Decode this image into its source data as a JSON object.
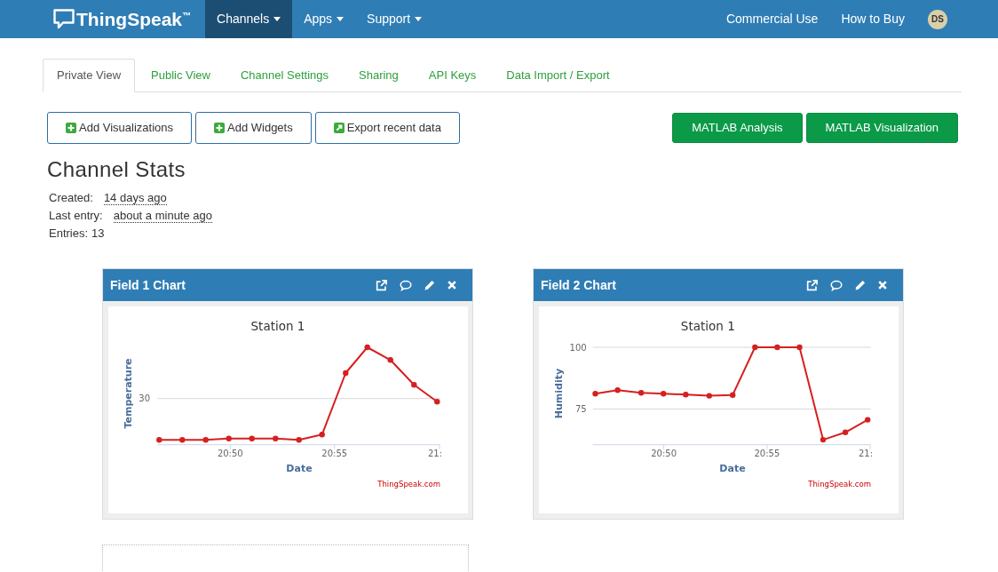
{
  "navbar": {
    "brand": "ThingSpeak$^{™}$",
    "menus": [
      {
        "label": "Channels",
        "selected": true,
        "dropdown": true
      },
      {
        "label": "Apps",
        "selected": false,
        "dropdown": true
      },
      {
        "label": "Support",
        "selected": false,
        "dropdown": true
      }
    ],
    "links": [
      "Commercial Use",
      "How to Buy"
    ],
    "avatar": "DS"
  },
  "tabs": [
    {
      "label": "Private View",
      "selected": true
    },
    {
      "label": "Public View",
      "selected": false
    },
    {
      "label": "Channel Settings",
      "selected": false
    },
    {
      "label": "Sharing",
      "selected": false
    },
    {
      "label": "API Keys",
      "selected": false
    },
    {
      "label": "Data Import / Export",
      "selected": false
    }
  ],
  "actions": [
    {
      "label": "Add Visualizations",
      "kind": "add"
    },
    {
      "label": "Add Widgets",
      "kind": "add"
    },
    {
      "label": "Export recent data",
      "kind": "export"
    }
  ],
  "matlab_buttons": [
    "MATLAB Analysis",
    "MATLAB Visualization"
  ],
  "channel_stats": {
    "title": "Channel Stats",
    "items": [
      {
        "label": "Created:",
        "value": "14 days ago",
        "kind": "time"
      },
      {
        "label": "Last entry:",
        "value": "about a minute ago",
        "kind": "time"
      },
      {
        "label": "Entries:",
        "value": "13",
        "kind": "count"
      }
    ]
  },
  "charts": [
    {
      "header": "Field 1 Chart",
      "picture": {
        "title": "Station 1",
        "xlabel": "Date",
        "ylabel": "Temperature",
        "x_tick_labels": [
          "20:50",
          "20:55",
          "21:"
        ],
        "y_tick_labels": [
          "30"
        ]
      },
      "credit": "ThingSpeak.com"
    },
    {
      "header": "Field 2 Chart",
      "chart_data": {
        "type": "line",
        "title": "Station 1",
        "xlabel": "Date",
        "ylabel": "Humidity",
        "x": [
          20.778,
          20.796,
          20.815,
          20.833,
          20.851,
          20.87,
          20.889,
          20.907,
          20.925,
          20.943,
          20.962,
          20.98,
          20.998
        ],
        "values": [
          81.2,
          82.7,
          81.6,
          81.2,
          80.9,
          80.4,
          80.7,
          100,
          100,
          100,
          62.6,
          65.6,
          70.7
        ],
        "color": "#d62020",
        "xlim": [
          20.776,
          21.0
        ],
        "ylim": [
          60.6,
          100
        ],
        "xticks": [
          {
            "value": 20.8333,
            "label": "20:50"
          },
          {
            "value": 20.9167,
            "label": "20:55"
          },
          {
            "value": 21.0,
            "label": "21:"
          }
        ],
        "yticks": [
          75,
          100
        ],
        "grid": true,
        "marker": "circle"
      },
      "credit": "ThingSpeak.com"
    }
  ],
  "empty_panel": true
}
